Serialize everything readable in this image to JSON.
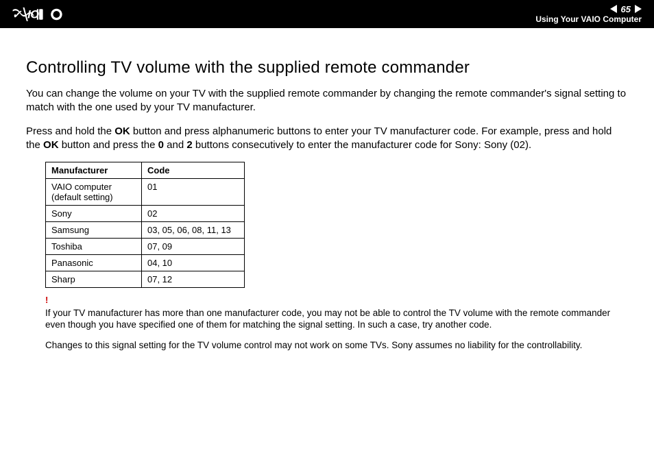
{
  "header": {
    "page_number": "65",
    "section": "Using Your VAIO Computer"
  },
  "title": "Controlling TV volume with the supplied remote commander",
  "para1": "You can change the volume on your TV with the supplied remote commander by changing the remote commander's signal setting to match with the one used by your TV manufacturer.",
  "para2_pre": "Press and hold the ",
  "para2_ok1": "OK",
  "para2_mid1": " button and press alphanumeric buttons to enter your TV manufacturer code. For example, press and hold the ",
  "para2_ok2": "OK",
  "para2_mid2": " button and press the ",
  "para2_zero": "0",
  "para2_and": " and ",
  "para2_two": "2",
  "para2_end": " buttons consecutively to enter the manufacturer code for Sony: Sony (02).",
  "table": {
    "headers": {
      "manufacturer": "Manufacturer",
      "code": "Code"
    },
    "rows": [
      {
        "manufacturer": "VAIO computer (default setting)",
        "code": "01"
      },
      {
        "manufacturer": "Sony",
        "code": "02"
      },
      {
        "manufacturer": "Samsung",
        "code": "03, 05, 06, 08, 11, 13"
      },
      {
        "manufacturer": "Toshiba",
        "code": "07, 09"
      },
      {
        "manufacturer": "Panasonic",
        "code": "04, 10"
      },
      {
        "manufacturer": "Sharp",
        "code": "07, 12"
      }
    ]
  },
  "warning_mark": "!",
  "note1": "If your TV manufacturer has more than one manufacturer code, you may not be able to control the TV volume with the remote commander even though you have specified one of them for matching the signal setting. In such a case, try another code.",
  "note2": "Changes to this signal setting for the TV volume control may not work on some TVs. Sony assumes no liability for the controllability."
}
